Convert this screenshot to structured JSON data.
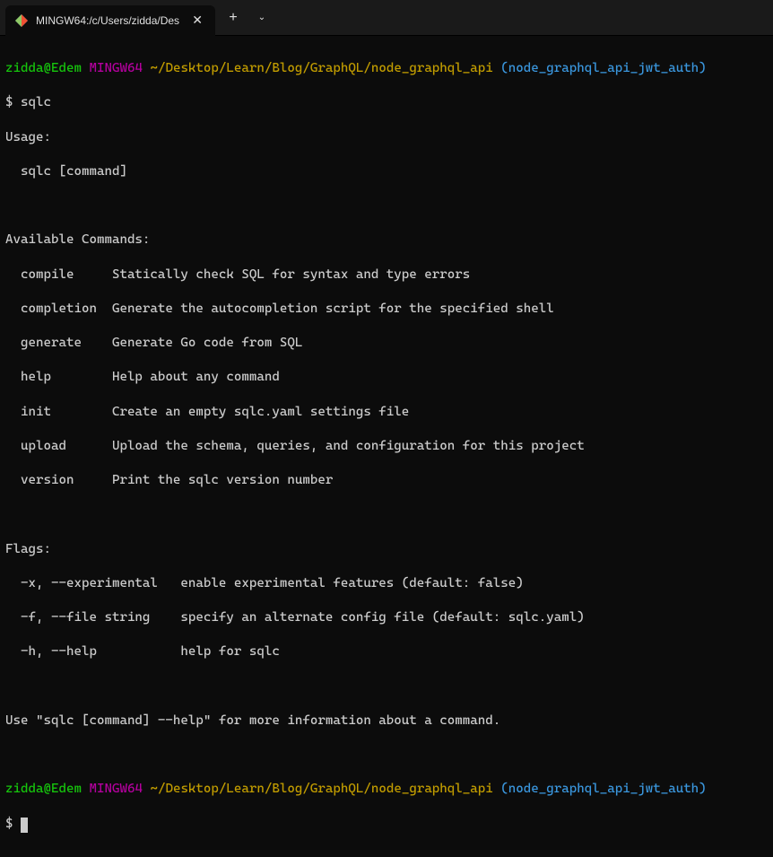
{
  "tab": {
    "title": "MINGW64:/c/Users/zidda/Des",
    "close_glyph": "✕"
  },
  "titlebar": {
    "new_tab_glyph": "+",
    "dropdown_glyph": "⌄"
  },
  "prompt1": {
    "user": "zidda@Edem",
    "mingw": "MINGW64",
    "path": "~/Desktop/Learn/Blog/GraphQL/node_graphql_api",
    "branch": "(node_graphql_api_jwt_auth)",
    "symbol": "$",
    "command": "sqlc"
  },
  "output": {
    "usage_header": "Usage:",
    "usage_line": "  sqlc [command]",
    "commands_header": "Available Commands:",
    "cmd_compile": "  compile     Statically check SQL for syntax and type errors",
    "cmd_completion": "  completion  Generate the autocompletion script for the specified shell",
    "cmd_generate": "  generate    Generate Go code from SQL",
    "cmd_help": "  help        Help about any command",
    "cmd_init": "  init        Create an empty sqlc.yaml settings file",
    "cmd_upload": "  upload      Upload the schema, queries, and configuration for this project",
    "cmd_version": "  version     Print the sqlc version number",
    "flags_header": "Flags:",
    "flag_x": "  -x, --experimental   enable experimental features (default: false)",
    "flag_f": "  -f, --file string    specify an alternate config file (default: sqlc.yaml)",
    "flag_h": "  -h, --help           help for sqlc",
    "footer": "Use \"sqlc [command] --help\" for more information about a command."
  },
  "prompt2": {
    "user": "zidda@Edem",
    "mingw": "MINGW64",
    "path": "~/Desktop/Learn/Blog/GraphQL/node_graphql_api",
    "branch": "(node_graphql_api_jwt_auth)",
    "symbol": "$"
  }
}
